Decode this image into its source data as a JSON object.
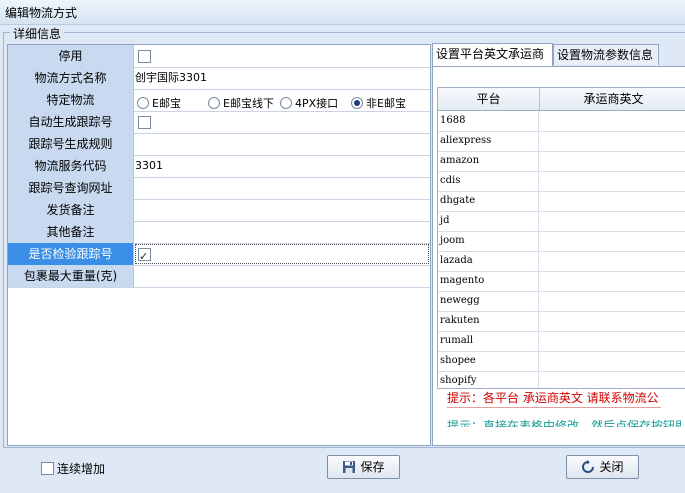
{
  "window": {
    "title": "编辑物流方式"
  },
  "group": {
    "caption": "详细信息"
  },
  "props": [
    {
      "label": "停用",
      "type": "checkbox",
      "checked": false
    },
    {
      "label": "物流方式名称",
      "type": "text",
      "value": "创宇国际3301"
    },
    {
      "label": "特定物流",
      "type": "radio"
    },
    {
      "label": "自动生成跟踪号",
      "type": "checkbox",
      "checked": false
    },
    {
      "label": "跟踪号生成规则",
      "type": "text",
      "value": ""
    },
    {
      "label": "物流服务代码",
      "type": "text",
      "value": "3301"
    },
    {
      "label": "跟踪号查询网址",
      "type": "text",
      "value": ""
    },
    {
      "label": "发货备注",
      "type": "text",
      "value": ""
    },
    {
      "label": "其他备注",
      "type": "text",
      "value": ""
    },
    {
      "label": "是否检验跟踪号",
      "type": "checkbox",
      "checked": true,
      "selected": true
    },
    {
      "label": "包裹最大重量(克)",
      "type": "text",
      "value": ""
    }
  ],
  "radio_options": [
    {
      "label": "E邮宝",
      "checked": false
    },
    {
      "label": "E邮宝线下",
      "checked": false
    },
    {
      "label": "4PX接口",
      "checked": false
    },
    {
      "label": "非E邮宝",
      "checked": true
    }
  ],
  "tabs": [
    {
      "label": "设置平台英文承运商",
      "active": true
    },
    {
      "label": "设置物流参数信息",
      "active": false
    }
  ],
  "grid": {
    "headers": [
      "平台",
      "承运商英文"
    ],
    "rows": [
      {
        "platform": "1688",
        "carrier": ""
      },
      {
        "platform": "aliexpress",
        "carrier": ""
      },
      {
        "platform": "amazon",
        "carrier": ""
      },
      {
        "platform": "cdis",
        "carrier": ""
      },
      {
        "platform": "dhgate",
        "carrier": ""
      },
      {
        "platform": "jd",
        "carrier": ""
      },
      {
        "platform": "joom",
        "carrier": ""
      },
      {
        "platform": "lazada",
        "carrier": ""
      },
      {
        "platform": "magento",
        "carrier": ""
      },
      {
        "platform": "newegg",
        "carrier": ""
      },
      {
        "platform": "rakuten",
        "carrier": ""
      },
      {
        "platform": "rumall",
        "carrier": ""
      },
      {
        "platform": "shopee",
        "carrier": ""
      },
      {
        "platform": "shopify",
        "carrier": ""
      }
    ]
  },
  "tips": {
    "line1": "提示：各平台 承运商英文 请联系物流公",
    "line2": "提示：直接在表格中修改，然后点保存按钮即"
  },
  "footer": {
    "continuous_add_label": "连续增加",
    "save_label": "保存",
    "close_label": "关闭"
  }
}
